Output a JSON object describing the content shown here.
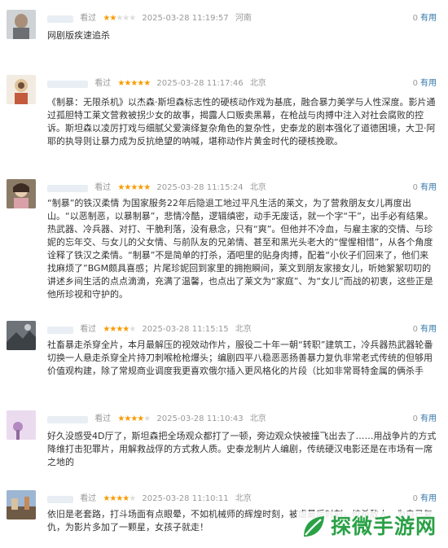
{
  "colors": {
    "star_filled": "#f99b01",
    "star_empty": "#dddddd",
    "link": "#3377aa",
    "meta": "#999999",
    "watermark": "#2aa146"
  },
  "reviews": [
    {
      "status": "看过",
      "stars": 2,
      "time": "2025-03-28 11:19:57",
      "location": "河南",
      "votes": "0",
      "useful_label": "有用",
      "text": "网剧版疾速追杀"
    },
    {
      "status": "看过",
      "stars": 5,
      "time": "2025-03-28 11:17:46",
      "location": "北京",
      "votes": "0",
      "useful_label": "有用",
      "text": "《制暴：无限杀机》以杰森·斯坦森标志性的硬核动作戏为基底，融合暴力美学与人性深度。影片通过孤胆特工莱文营救被拐少女的故事，揭露人口贩卖黑幕，在枪战与肉搏中注入对社会腐败的控诉。斯坦森以凌厉打戏与细腻父爱演绎复杂角色的复杂性，史泰龙的剧本强化了道德困境，大卫·阿耶的执导则让暴力成为反抗绝望的呐喊，堪称动作片黄金时代的硬核挽歌。"
    },
    {
      "status": "看过",
      "stars": 5,
      "time": "2025-03-28 11:15:24",
      "location": "北京",
      "votes": "0",
      "useful_label": "有用",
      "text": "“制暴”的铁汉柔情 为国家服务22年后隐退工地过平凡生活的莱文，为了营救朋友女儿再度出山。“以恶制恶，以暴制暴”，悲情冷酷，逻辑缜密，动手无废话，就一个字“干”，出手必有结果。热武器、冷兵器、对打、干脆利落，没有悬念，只有“爽”。但他并不冷血，与雇主家的交情、与珍妮的忘年交、与女儿的父女情、与前队友的兄弟情、甚至和黑光头老大的“惺惺相惜”，从各个角度诠释了铁汉之柔情。“制暴”不是简单的打杀，酒吧里的贴身肉搏，配着“小伙子们回来了，他们来找麻烦了”BGM颇具喜感；片尾珍妮回到家里的拥抱瞬间，莱文到朋友家接女儿，听她絮絮叨叨的讲述乡间生活的点点滴滴，充满了温馨，也点出了莱文为“家庭”、为“女儿”而战的初衷，这些正是他所珍视和守护的。"
    },
    {
      "status": "看过",
      "stars": 4,
      "time": "2025-03-28 11:15:15",
      "location": "北京",
      "votes": "0",
      "useful_label": "有用",
      "text": "社畜暴走杀穿全片，本月最解压的视效动作片，服役二十年一朝“转职”建筑工，冷兵器热武器轮番切换一人悬走杀穿全片持刀刺喉枪枪爆头；编剧四平八稳恶恶扬善暴力复仇非常老式传统的但够用价值观构建，除了常规商业调度我更喜欢俄尔插入更风格化的片段（比如非常哥特金属的俩杀手"
    },
    {
      "status": "看过",
      "stars": 4,
      "time": "2025-03-28 11:10:43",
      "location": "北京",
      "votes": "0",
      "useful_label": "有用",
      "text": "好久没感受4D厅了，斯坦森把全场观众都打了一顿，旁边观众快被撞飞出去了……用战争片的方式降维打击犯罪片，用解救战俘的方式救人质。史泰龙制片人编剧，传统硬汉电影还是在市场有一席之地的"
    },
    {
      "status": "看过",
      "stars": 4,
      "time": "2025-03-28 11:10:11",
      "location": "北京",
      "votes": "0",
      "useful_label": "有用",
      "text": "依旧是老套路，打斗场面有点眼晕，不如机械师的辉煌时刻，被虐最后时刻，绞杀敌人，为自己复仇，为影片多加了一颗星，女孩子就走！"
    }
  ],
  "watermark": {
    "text": "探微手游网"
  }
}
